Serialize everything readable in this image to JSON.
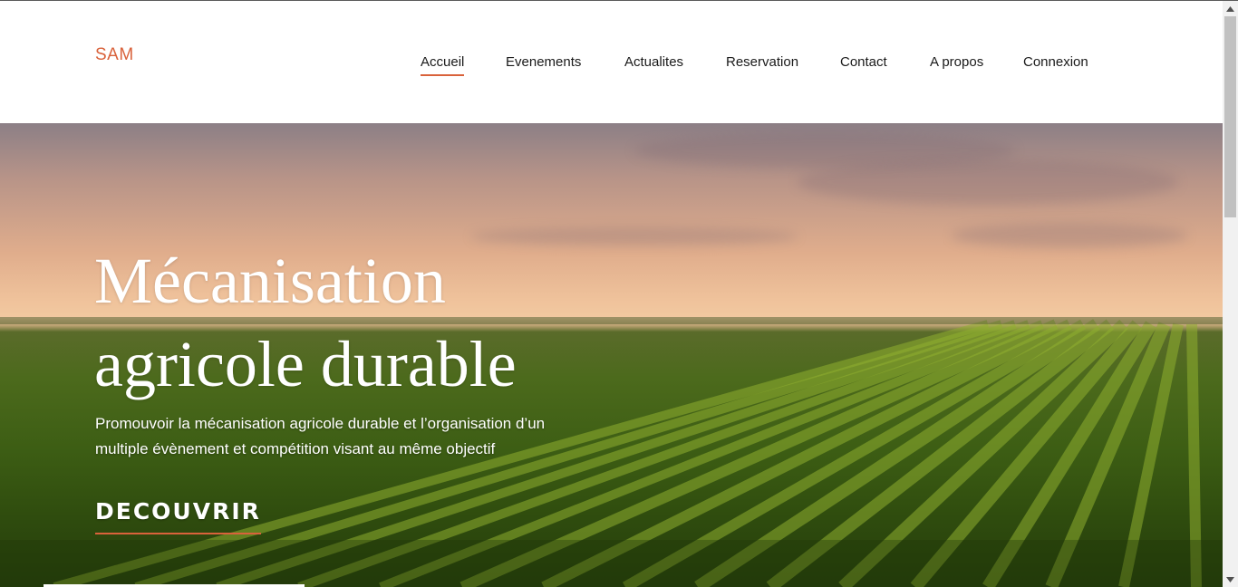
{
  "header": {
    "logo": "SAM",
    "nav": [
      {
        "label": "Accueil",
        "active": true
      },
      {
        "label": "Evenements",
        "active": false
      },
      {
        "label": "Actualites",
        "active": false
      },
      {
        "label": "Reservation",
        "active": false
      },
      {
        "label": "Contact",
        "active": false
      },
      {
        "label": "A propos",
        "active": false
      },
      {
        "label": "Connexion",
        "active": false
      }
    ]
  },
  "hero": {
    "title": "Mécanisation agricole durable",
    "subtitle": "Promouvoir la mécanisation agricole durable et l’organisation d’un multiple évènement et compétition visant au même objectif",
    "cta": "DECOUVRIR"
  },
  "colors": {
    "accent": "#d9623b",
    "nav_text": "#1a1a1a",
    "hero_text": "#ffffff"
  },
  "icons": {
    "scroll_up": "chevron-up-icon",
    "scroll_down": "chevron-down-icon"
  }
}
